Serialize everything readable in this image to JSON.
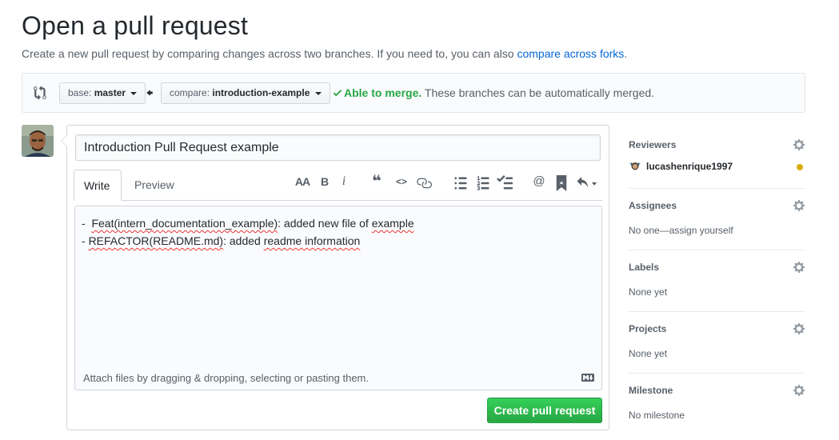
{
  "header": {
    "title": "Open a pull request",
    "subtitle": "Create a new pull request by comparing changes across two branches. If you need to, you can also ",
    "subtitle_link": "compare across forks",
    "subtitle_end": "."
  },
  "range": {
    "base_prefix": "base: ",
    "base_branch": "master",
    "compare_prefix": "compare: ",
    "compare_branch": "introduction-example",
    "merge_ok": "Able to merge.",
    "merge_text": " These branches can be automatically merged.",
    "ok_color": "#28a745"
  },
  "form": {
    "title_value": "Introduction Pull Request example",
    "tabs": [
      {
        "label": "Write"
      },
      {
        "label": "Preview"
      }
    ],
    "toolbar": {
      "header": "AA",
      "bold": "B",
      "italic": "i",
      "quote": "❝",
      "code": "<>",
      "mention": "@"
    },
    "body_lines": [
      {
        "pre": "-  ",
        "a": "Feat(intern_documentation_example)",
        "mid": ": added new file of ",
        "b": "example"
      },
      {
        "pre": "- ",
        "a": "REFACTOR(README.md)",
        "mid": ": added ",
        "b": "readme information"
      }
    ],
    "attach_text": "Attach files by dragging & dropping, selecting or pasting them.",
    "submit_label": "Create pull request",
    "submit_color": "#28a745"
  },
  "sidebar": {
    "reviewers": {
      "heading": "Reviewers",
      "user": "lucashenrique1997",
      "status_color": "#dbab09"
    },
    "assignees": {
      "heading": "Assignees",
      "value": "No one—assign yourself"
    },
    "labels": {
      "heading": "Labels",
      "value": "None yet"
    },
    "projects": {
      "heading": "Projects",
      "value": "None yet"
    },
    "milestone": {
      "heading": "Milestone",
      "value": "No milestone"
    }
  }
}
